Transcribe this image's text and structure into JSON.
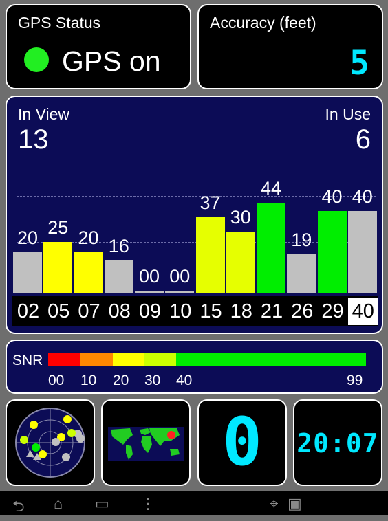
{
  "gps_status": {
    "title": "GPS Status",
    "state": "GPS on",
    "indicator_color": "#22ee22"
  },
  "accuracy": {
    "title": "Accuracy (feet)",
    "value": "5"
  },
  "satellites": {
    "in_view_label": "In View",
    "in_view": "13",
    "in_use_label": "In Use",
    "in_use": "6",
    "bars": [
      {
        "prn": "02",
        "snr": "20",
        "value": 20,
        "color": "#c0c0c0"
      },
      {
        "prn": "05",
        "snr": "25",
        "value": 25,
        "color": "#ffff00"
      },
      {
        "prn": "07",
        "snr": "20",
        "value": 20,
        "color": "#ffff00"
      },
      {
        "prn": "08",
        "snr": "16",
        "value": 16,
        "color": "#c0c0c0"
      },
      {
        "prn": "09",
        "snr": "00",
        "value": 0,
        "color": "#c0c0c0"
      },
      {
        "prn": "10",
        "snr": "00",
        "value": 0,
        "color": "#c0c0c0"
      },
      {
        "prn": "15",
        "snr": "37",
        "value": 37,
        "color": "#e6ff00"
      },
      {
        "prn": "18",
        "snr": "30",
        "value": 30,
        "color": "#e6ff00"
      },
      {
        "prn": "21",
        "snr": "44",
        "value": 44,
        "color": "#00ee00"
      },
      {
        "prn": "26",
        "snr": "19",
        "value": 19,
        "color": "#c0c0c0"
      },
      {
        "prn": "29",
        "snr": "40",
        "value": 40,
        "color": "#00ee00"
      },
      {
        "prn": "40",
        "snr": "40",
        "value": 40,
        "color": "#c0c0c0",
        "selected": true
      }
    ]
  },
  "snr_scale": {
    "label": "SNR",
    "ticks": [
      "00",
      "10",
      "20",
      "30",
      "40",
      "99"
    ],
    "colors": [
      "#ff0000",
      "#ff8800",
      "#ffff00",
      "#ccff00",
      "#00ee00"
    ]
  },
  "widgets": {
    "satellite_count": "0",
    "clock": "20:07"
  },
  "chart_data": {
    "type": "bar",
    "categories": [
      "02",
      "05",
      "07",
      "08",
      "09",
      "10",
      "15",
      "18",
      "21",
      "26",
      "29",
      "40"
    ],
    "values": [
      20,
      25,
      20,
      16,
      0,
      0,
      37,
      30,
      44,
      19,
      40,
      40
    ],
    "ylim": [
      0,
      60
    ]
  }
}
